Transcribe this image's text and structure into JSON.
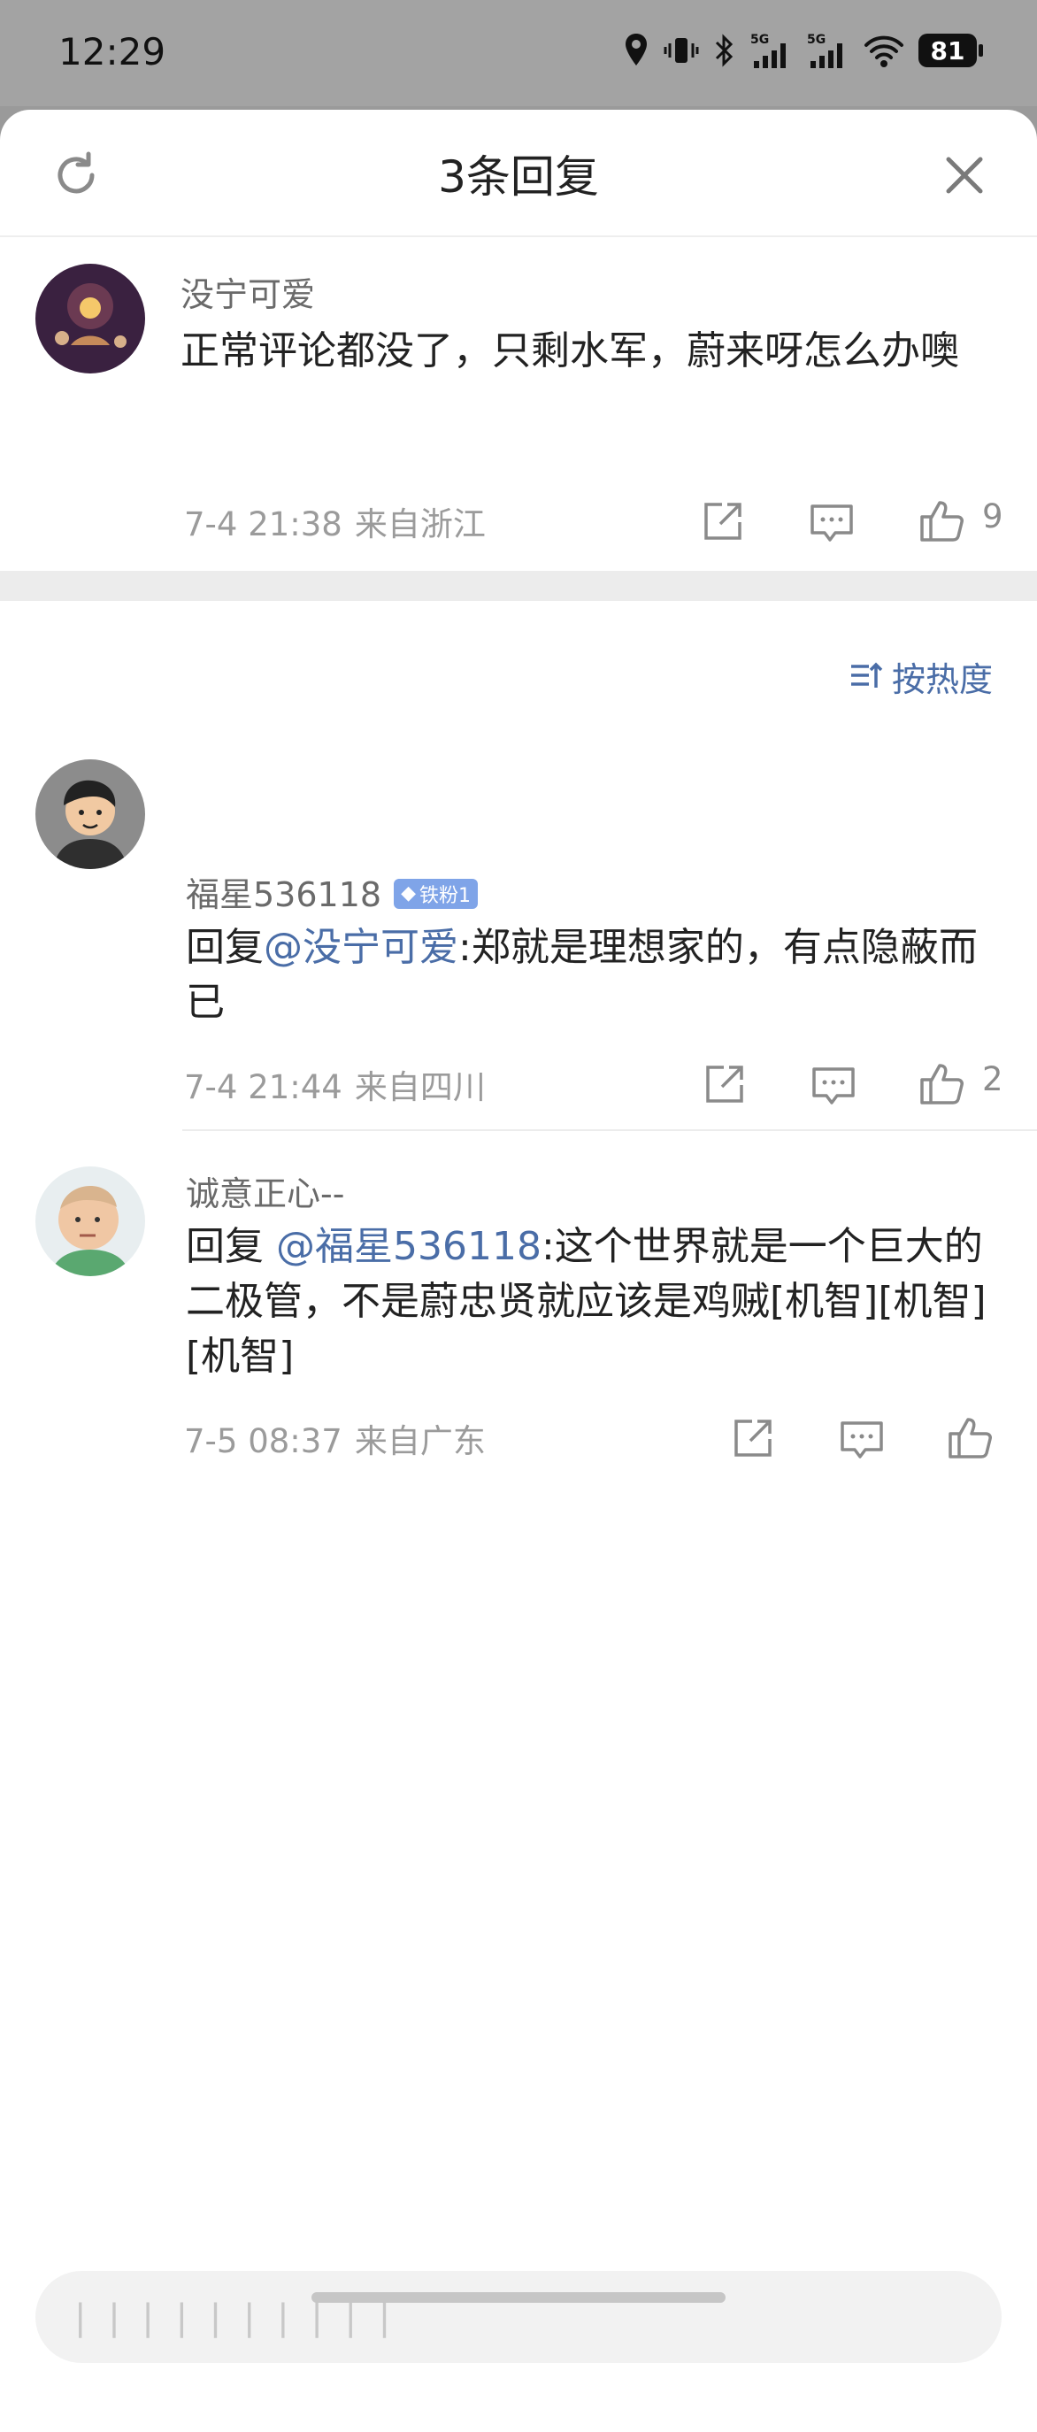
{
  "status_bar": {
    "time": "12:29",
    "battery": "81",
    "signal_label": "5G"
  },
  "sheet": {
    "title": "3条回复"
  },
  "main_comment": {
    "username": "没宁可爱",
    "text": "正常评论都没了，只剩水军，蔚来呀怎么办噢",
    "date": "7-4 21:38",
    "location": "来自浙江",
    "likes": "9"
  },
  "sort": {
    "label": "按热度"
  },
  "replies": [
    {
      "username": "福星536118",
      "badge": "铁粉1",
      "prefix": "回复",
      "mention": "@没宁可爱",
      "text": ":郑就是理想家的，有点隐蔽而已",
      "date": "7-4 21:44",
      "location": "来自四川",
      "likes": "2"
    },
    {
      "username": "诚意正心--",
      "prefix": "回复 ",
      "mention": "@福星536118",
      "text": ":这个世界就是一个巨大的二极管，不是蔚忠贤就应该是鸡贼[机智][机智][机智]",
      "date": "7-5 08:37",
      "location": "来自广东"
    }
  ],
  "input": {
    "placeholder": "| | | | | | |   | | |"
  },
  "colors": {
    "accent": "#4a6da7",
    "meta_gray": "#9b9b9b",
    "band": "#ececec"
  }
}
